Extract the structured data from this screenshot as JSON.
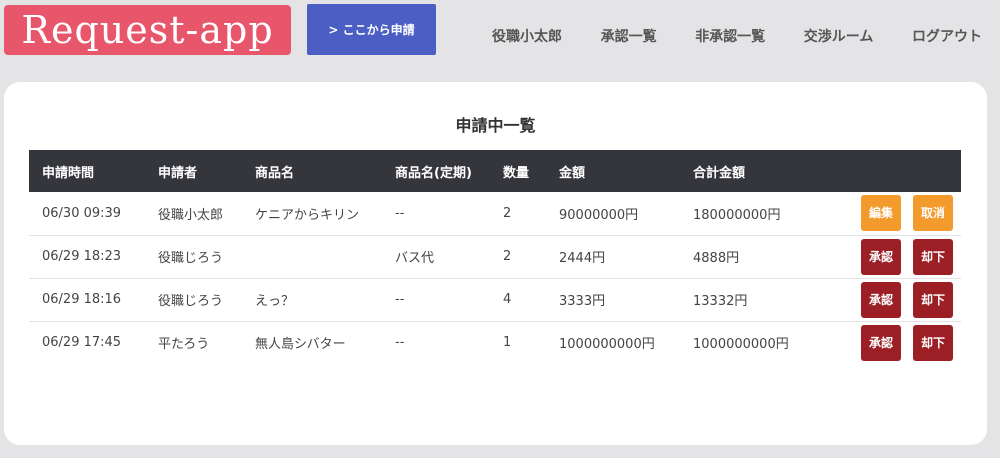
{
  "app": {
    "logo": "Request-app"
  },
  "header": {
    "cta_label": "> ここから申請",
    "nav": [
      "役職小太郎",
      "承認一覧",
      "非承認一覧",
      "交渉ルーム",
      "ログアウト"
    ]
  },
  "main": {
    "title": "申請中一覧",
    "columns": [
      "申請時間",
      "申請者",
      "商品名",
      "商品名(定期)",
      "数量",
      "金額",
      "合計金額"
    ],
    "rows": [
      {
        "time": "06/30 09:39",
        "applicant": "役職小太郎",
        "product": "ケニアからキリン",
        "product_recurring": "--",
        "qty": "2",
        "price": "90000000円",
        "total": "180000000円",
        "btn1": "編集",
        "btn2": "取消"
      },
      {
        "time": "06/29 18:23",
        "applicant": "役職じろう",
        "product": "",
        "product_recurring": "バス代",
        "qty": "2",
        "price": "2444円",
        "total": "4888円",
        "btn1": "承認",
        "btn2": "却下"
      },
      {
        "time": "06/29 18:16",
        "applicant": "役職じろう",
        "product": "えっ？",
        "product_recurring": "--",
        "qty": "4",
        "price": "3333円",
        "total": "13332円",
        "btn1": "承認",
        "btn2": "却下"
      },
      {
        "time": "06/29 17:45",
        "applicant": "平たろう",
        "product": "無人島シバター",
        "product_recurring": "--",
        "qty": "1",
        "price": "1000000000円",
        "total": "1000000000円",
        "btn1": "承認",
        "btn2": "却下"
      }
    ]
  },
  "colors": {
    "logo_bg": "#e8566b",
    "cta_bg": "#4a5ec4",
    "header_row_bg": "#35363b",
    "edit_button": "#f39a2d",
    "approve_button": "#9b1f24"
  }
}
